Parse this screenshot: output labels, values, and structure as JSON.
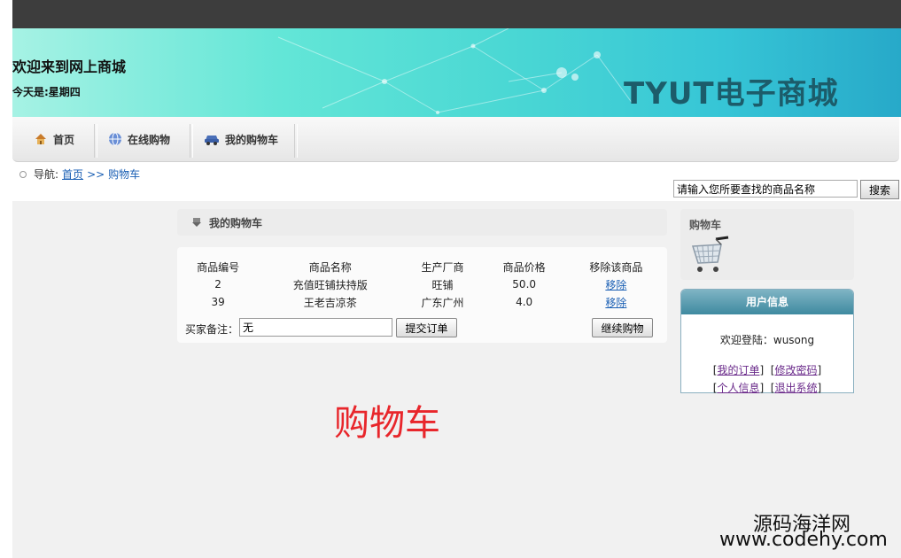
{
  "header": {
    "welcome": "欢迎来到网上商城",
    "today": "今天是:星期四",
    "brand": "TYUT电子商城"
  },
  "nav": {
    "items": [
      {
        "label": "首页",
        "icon": "home-icon"
      },
      {
        "label": "在线购物",
        "icon": "globe-icon"
      },
      {
        "label": "我的购物车",
        "icon": "car-icon"
      }
    ]
  },
  "breadcrumb": {
    "prefix": "导航:",
    "home": "首页",
    "sep": ">>",
    "current": "购物车"
  },
  "search": {
    "value": "请输入您所要查找的商品名称",
    "button": "搜索"
  },
  "cart": {
    "title": "我的购物车",
    "columns": [
      "商品编号",
      "商品名称",
      "生产厂商",
      "商品价格",
      "移除该商品"
    ],
    "rows": [
      {
        "id": "2",
        "name": "充值旺铺扶持版",
        "maker": "旺铺",
        "price": "50.0",
        "action": "移除"
      },
      {
        "id": "39",
        "name": "王老吉凉茶",
        "maker": "广东广州",
        "price": "4.0",
        "action": "移除"
      }
    ],
    "remark_label": "买家备注：",
    "remark_value": "无",
    "submit": "提交订单",
    "continue": "继续购物"
  },
  "page_label": "购物车",
  "side_cart": {
    "title": "购物车",
    "icon": "shopping-cart-icon"
  },
  "user": {
    "title": "用户信息",
    "greeting": "欢迎登陆：wusong",
    "links": [
      "我的订单",
      "修改密码",
      "个人信息",
      "退出系统"
    ]
  },
  "watermark": {
    "line1": "源码海洋网",
    "line2": "www.codehy.com"
  },
  "colors": {
    "topbar": "#3d3d3d",
    "brand_text": "#1c5c6a",
    "link": "#1a5fb4",
    "page_label": "#e8262b",
    "user_header": "#4f94a8"
  }
}
